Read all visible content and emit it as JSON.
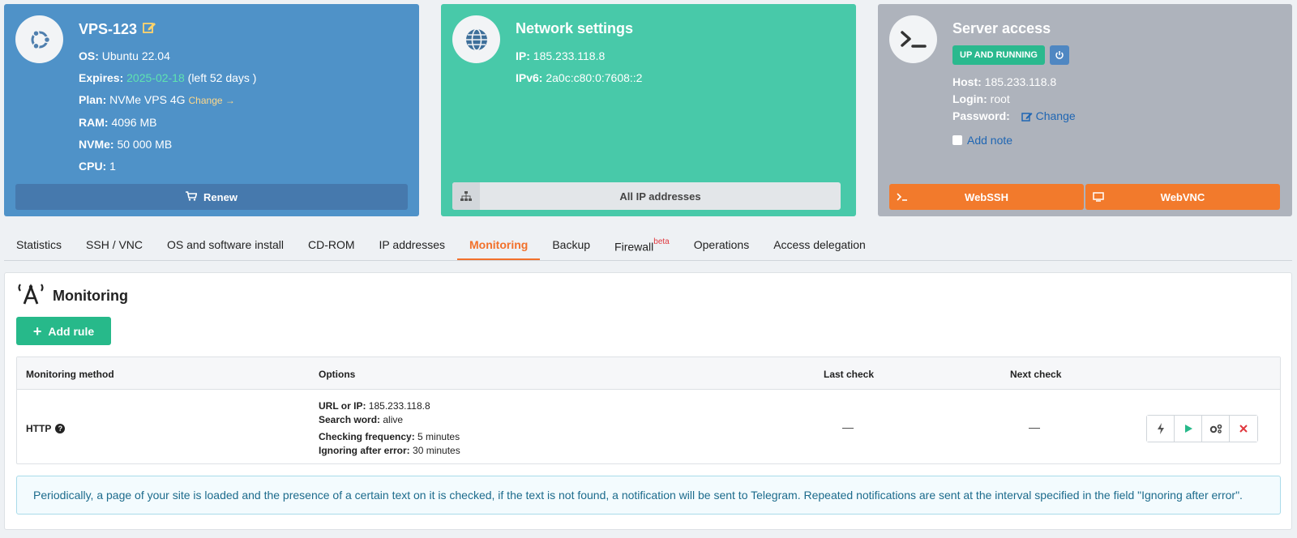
{
  "vps": {
    "name": "VPS-123",
    "os_label": "OS:",
    "os_value": "Ubuntu 22.04",
    "expires_label": "Expires:",
    "expires_date": "2025-02-18",
    "expires_left": "(left 52 days )",
    "plan_label": "Plan:",
    "plan_value": "NVMe VPS 4G",
    "plan_change": "Change →",
    "ram_label": "RAM:",
    "ram_value": "4096 MB",
    "nvme_label": "NVMe:",
    "nvme_value": "50 000 MB",
    "cpu_label": "CPU:",
    "cpu_value": "1",
    "renew_label": "Renew"
  },
  "network": {
    "title": "Network settings",
    "ip_label": "IP:",
    "ip_value": "185.233.118.8",
    "ipv6_label": "IPv6:",
    "ipv6_value": "2a0c:c80:0:7608::2",
    "all_ip_label": "All IP addresses"
  },
  "server": {
    "title": "Server access",
    "status": "UP AND RUNNING",
    "host_label": "Host:",
    "host_value": "185.233.118.8",
    "login_label": "Login:",
    "login_value": "root",
    "password_label": "Password:",
    "password_change": "Change",
    "add_note": "Add note",
    "webssh_label": "WebSSH",
    "webvnc_label": "WebVNC"
  },
  "tabs": [
    {
      "label": "Statistics"
    },
    {
      "label": "SSH / VNC"
    },
    {
      "label": "OS and software install"
    },
    {
      "label": "CD-ROM"
    },
    {
      "label": "IP addresses"
    },
    {
      "label": "Monitoring"
    },
    {
      "label": "Backup"
    },
    {
      "label": "Firewall",
      "sup": "beta"
    },
    {
      "label": "Operations"
    },
    {
      "label": "Access delegation"
    }
  ],
  "monitoring": {
    "title": "Monitoring",
    "add_rule": "Add rule",
    "columns": {
      "method": "Monitoring method",
      "options": "Options",
      "last_check": "Last check",
      "next_check": "Next check"
    },
    "rule": {
      "method": "HTTP",
      "url_label": "URL or IP:",
      "url_value": "185.233.118.8",
      "search_label": "Search word:",
      "search_value": "alive",
      "freq_label": "Checking frequency:",
      "freq_value": "5 minutes",
      "ignore_label": "Ignoring after error:",
      "ignore_value": "30 minutes",
      "last_check": "—",
      "next_check": "—"
    },
    "info": "Periodically, a page of your site is loaded and the presence of a certain text on it is checked, if the text is not found, a notification will be sent to Telegram. Repeated notifications are sent at the interval specified in the field \"Ignoring after error\"."
  },
  "colors": {
    "vps_card": "#4f92c8",
    "network_card": "#48c9a9",
    "server_card": "#aeb3bc",
    "accent_orange": "#f2712b",
    "accent_green": "#27b98a"
  }
}
